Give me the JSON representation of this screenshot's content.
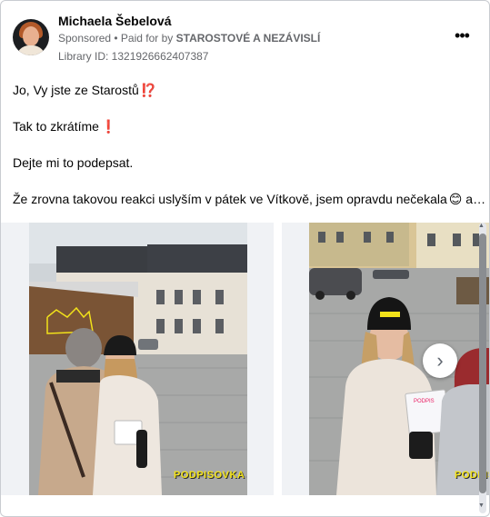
{
  "post": {
    "author": "Michaela Šebelová",
    "sponsored_label": "Sponsored",
    "paid_for_prefix": "• Paid for by",
    "paid_for_by": "STAROSTOVÉ A NEZÁVISLÍ",
    "library_id": "Library ID: 1321926662407387",
    "more_icon": "more-horizontal-icon",
    "lines": [
      "Jo, Vy jste ze Starostů",
      "Tak to zkrátíme",
      "Dejte mi to podepsat.",
      "Že zrovna takovou reakci uslyším v pátek ve Vítkově, jsem opravdu nečekala"
    ],
    "emoji_1": "⁉️",
    "emoji_2": "❗",
    "emoji_3": "😊",
    "ellipsis": "a…"
  },
  "carousel": {
    "slide_1_stamp": "PODPISOVKA",
    "slide_2_stamp": "PODPISO",
    "next_icon": "chevron-right-icon",
    "next_label": "›"
  },
  "scrollbar": {
    "up": "▲",
    "down": "▼"
  },
  "colors": {
    "stamp_yellow": "#f2e21a",
    "text_secondary": "#65676b",
    "border": "#c9ccd1"
  }
}
